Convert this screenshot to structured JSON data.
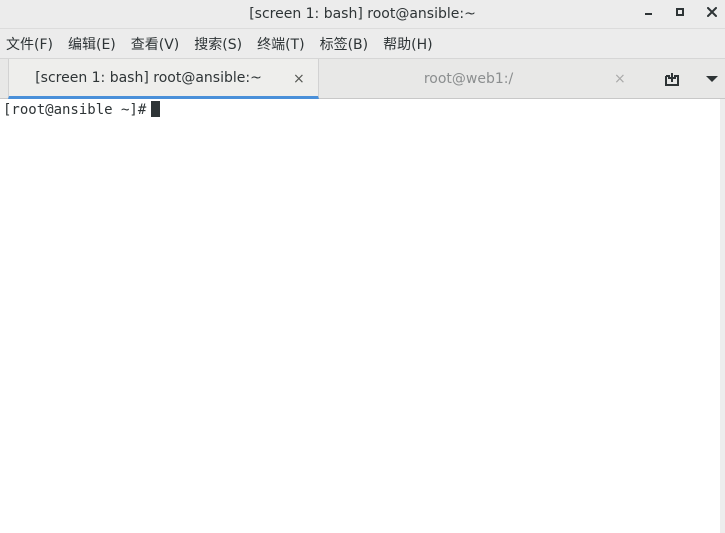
{
  "window": {
    "title": "[screen 1: bash] root@ansible:~"
  },
  "menu": [
    {
      "label": "文件(F)"
    },
    {
      "label": "编辑(E)"
    },
    {
      "label": "查看(V)"
    },
    {
      "label": "搜索(S)"
    },
    {
      "label": "终端(T)"
    },
    {
      "label": "标签(B)"
    },
    {
      "label": "帮助(H)"
    }
  ],
  "tabs": [
    {
      "label": "[screen 1: bash] root@ansible:~",
      "close": "×",
      "active": true
    },
    {
      "label": "root@web1:/",
      "close": "×",
      "active": false
    }
  ],
  "terminal": {
    "prompt": "[root@ansible ~]#"
  },
  "icons": {
    "minimize": "minimize-icon",
    "maximize": "maximize-icon",
    "close": "close-icon",
    "new_tab": "new-tab-icon",
    "tab_menu": "chevron-down-icon"
  },
  "colors": {
    "accent": "#4a90d9",
    "text": "#2e3436",
    "inactive_text": "#8b8e8f"
  }
}
